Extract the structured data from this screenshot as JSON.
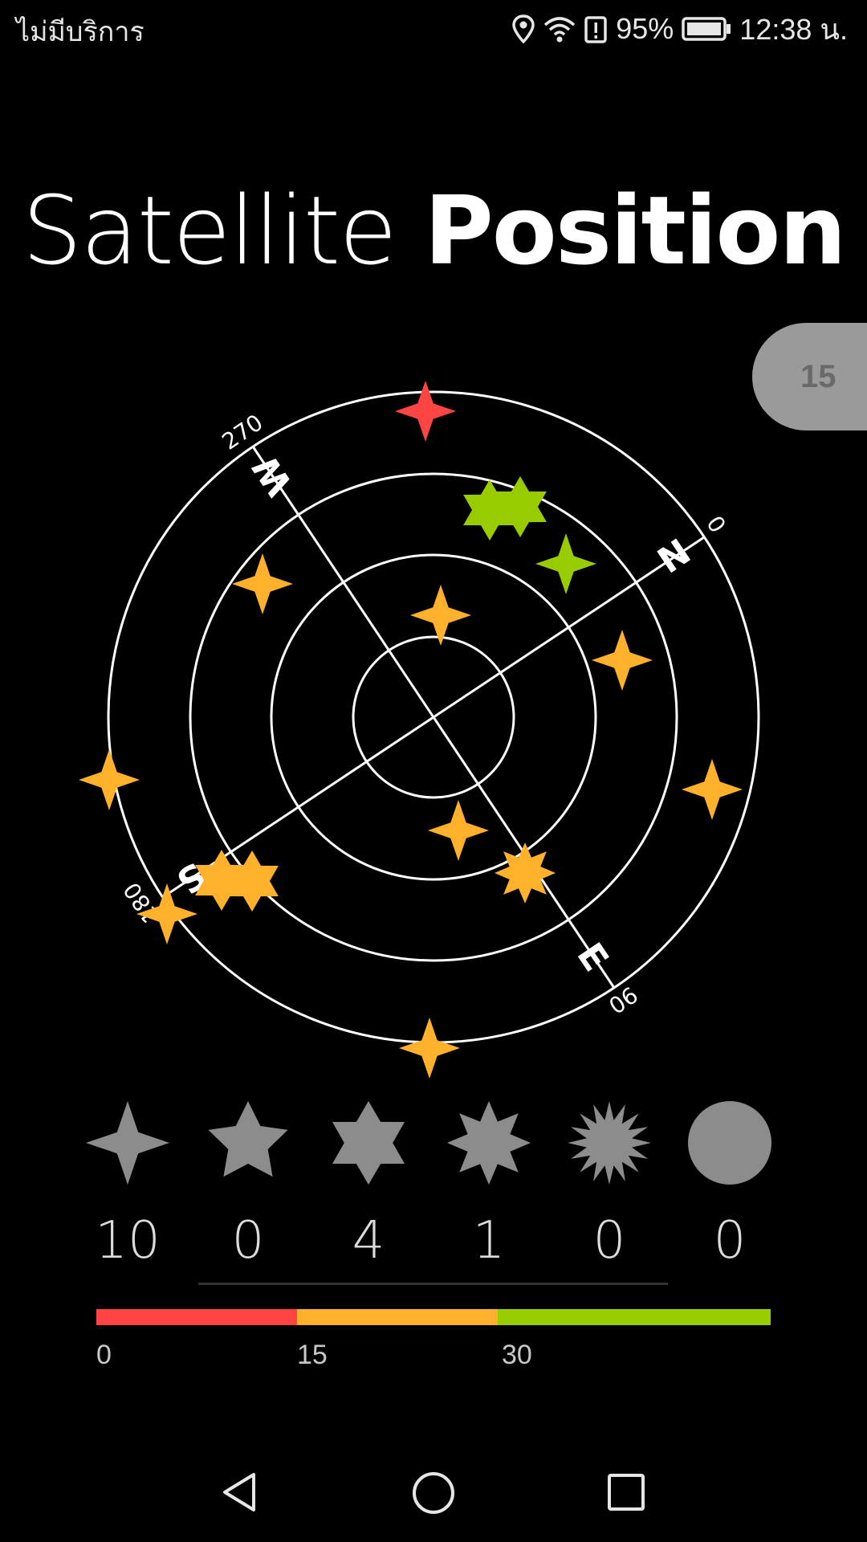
{
  "status_bar": {
    "carrier": "ไม่มีบริการ",
    "battery_percent": "95%",
    "time": "12:38 น.",
    "icons": [
      "location-icon",
      "wifi-icon",
      "battery-alert-icon",
      "battery-icon"
    ]
  },
  "title": {
    "light": "Satellite ",
    "bold": "Position"
  },
  "satellite_count": "15",
  "sky_plot": {
    "direction_labels": [
      "N",
      "E",
      "S",
      "W"
    ],
    "degree_labels": [
      "0",
      "90",
      "180",
      "270"
    ],
    "satellites": [
      {
        "shape": "star4",
        "color": "red"
      },
      {
        "shape": "star6",
        "color": "green"
      },
      {
        "shape": "star6",
        "color": "green"
      },
      {
        "shape": "star4",
        "color": "green"
      },
      {
        "shape": "star4",
        "color": "orange"
      },
      {
        "shape": "star4",
        "color": "orange"
      },
      {
        "shape": "star4",
        "color": "orange"
      },
      {
        "shape": "star4",
        "color": "orange"
      },
      {
        "shape": "star4",
        "color": "orange"
      },
      {
        "shape": "star4",
        "color": "orange"
      },
      {
        "shape": "star4",
        "color": "orange"
      },
      {
        "shape": "star8",
        "color": "orange"
      },
      {
        "shape": "star6",
        "color": "orange"
      },
      {
        "shape": "star6",
        "color": "orange"
      },
      {
        "shape": "star4",
        "color": "orange"
      }
    ]
  },
  "legend": [
    {
      "icon": "four-point-star-icon",
      "count": "10"
    },
    {
      "icon": "five-point-star-icon",
      "count": "0"
    },
    {
      "icon": "six-point-star-icon",
      "count": "4"
    },
    {
      "icon": "eight-point-star-icon",
      "count": "1"
    },
    {
      "icon": "burst-star-icon",
      "count": "0"
    },
    {
      "icon": "circle-icon",
      "count": "0"
    }
  ],
  "signal_scale": {
    "labels": [
      "0",
      "15",
      "30"
    ],
    "colors": {
      "red": "#ff4444",
      "orange": "#ffb12b",
      "green": "#99cc00"
    }
  },
  "nav_bar": {
    "icons": [
      "back-icon",
      "home-icon",
      "recents-icon"
    ]
  }
}
